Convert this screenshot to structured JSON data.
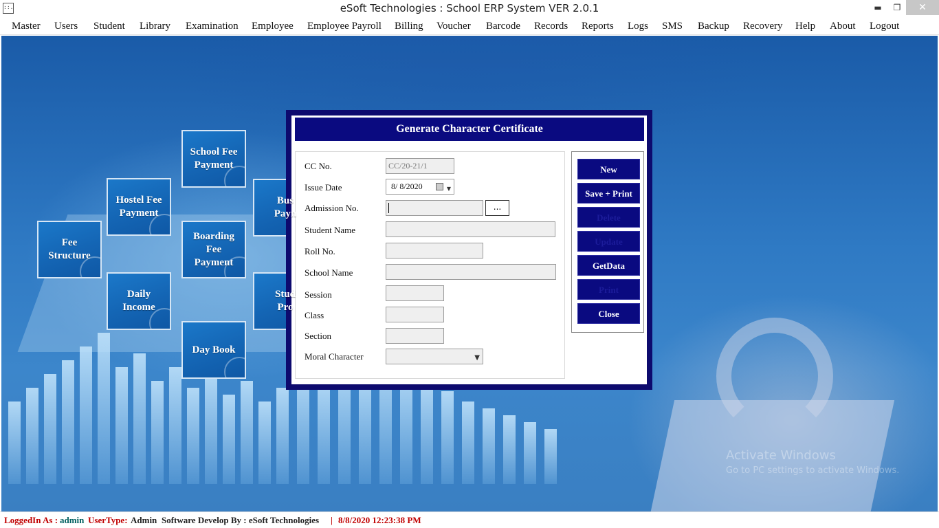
{
  "window": {
    "title": "eSoft Technologies : School ERP System VER 2.0.1",
    "min_glyph": "▬",
    "max_glyph": "❐",
    "close_glyph": "✕",
    "icon_text": "::."
  },
  "menu": [
    "Master",
    "Users",
    "Student",
    "Library",
    "Examination",
    "Employee",
    "Employee Payroll",
    "Billing",
    "Voucher",
    "Barcode",
    "Records",
    "Reports",
    "Logs",
    "SMS",
    "Backup",
    "Recovery",
    "Help",
    "About",
    "Logout"
  ],
  "tiles": [
    {
      "label": "Fee\nStructure"
    },
    {
      "label": "Hostel Fee\nPayment"
    },
    {
      "label": "Daily\nIncome"
    },
    {
      "label": "School Fee\nPayment"
    },
    {
      "label": "Boarding\nFee\nPayment"
    },
    {
      "label": "Day Book"
    },
    {
      "label": "Bus\nPayn"
    },
    {
      "label": "Stud\nPro"
    }
  ],
  "dialog": {
    "title": "Generate Character Certificate",
    "labels": {
      "cc_no": "CC No.",
      "issue_date": "Issue Date",
      "admission_no": "Admission No.",
      "student_name": "Student Name",
      "roll_no": "Roll No.",
      "school_name": "School Name",
      "session": "Session",
      "class": "Class",
      "section": "Section",
      "moral_character": "Moral Character"
    },
    "values": {
      "cc_no": "CC/20-21/1",
      "issue_date": "8/  8/2020",
      "admission_no": "",
      "student_name": "",
      "roll_no": "",
      "school_name": "",
      "session": "",
      "class": "",
      "section": "",
      "moral_character": ""
    },
    "lookup_label": "...",
    "dropdown_glyph": "▼",
    "buttons": {
      "new": "New",
      "save_print": "Save + Print",
      "delete": "Delete",
      "update": "Update",
      "getdata": "GetData",
      "print": "Print",
      "close": "Close"
    }
  },
  "status": {
    "logged_label": "LoggedIn As :",
    "user": "admin",
    "usertype_label": "UserType:",
    "usertype": "Admin",
    "developer": "Software Develop By : eSoft Technologies",
    "separator": "|",
    "datetime": "8/8/2020 12:23:38 PM"
  },
  "watermark": {
    "line1": "Activate Windows",
    "line2": "Go to PC settings to activate Windows."
  },
  "colors": {
    "dialog_frame": "#0d0a6e",
    "header_bg": "#0a0a80",
    "status_red": "#c00000",
    "status_teal": "#006060"
  }
}
